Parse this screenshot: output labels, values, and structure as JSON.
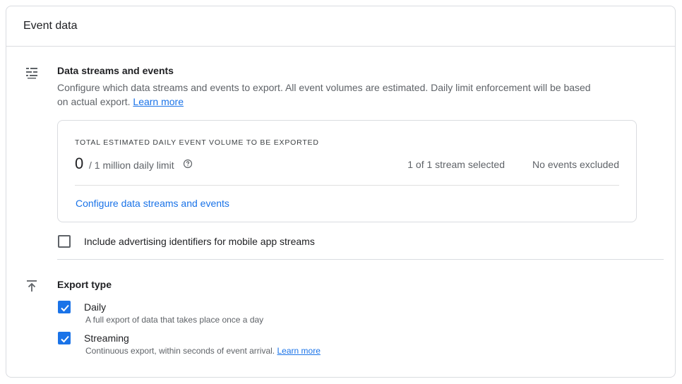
{
  "card": {
    "title": "Event data"
  },
  "data_streams": {
    "title": "Data streams and events",
    "description": "Configure which data streams and events to export. All event volumes are estimated. Daily limit enforcement will be based on actual export.",
    "learn_more": "Learn more",
    "icon": "filter-list-icon"
  },
  "volume": {
    "label": "TOTAL ESTIMATED DAILY EVENT VOLUME TO BE EXPORTED",
    "count": "0",
    "limit": "/ 1 million daily limit",
    "streams_selected": "1 of 1 stream selected",
    "events_excluded": "No events excluded",
    "configure_link": "Configure data streams and events"
  },
  "ad_identifiers": {
    "label": "Include advertising identifiers for mobile app streams",
    "checked": false
  },
  "export_type": {
    "title": "Export type",
    "icon": "upload-icon",
    "daily": {
      "label": "Daily",
      "sublabel": "A full export of data that takes place once a day",
      "checked": true
    },
    "streaming": {
      "label": "Streaming",
      "sublabel": "Continuous export, within seconds of event arrival.",
      "learn_more": "Learn more",
      "checked": true
    }
  },
  "colors": {
    "accent": "#1a73e8",
    "border": "#dadce0",
    "secondary_text": "#5f6368"
  }
}
